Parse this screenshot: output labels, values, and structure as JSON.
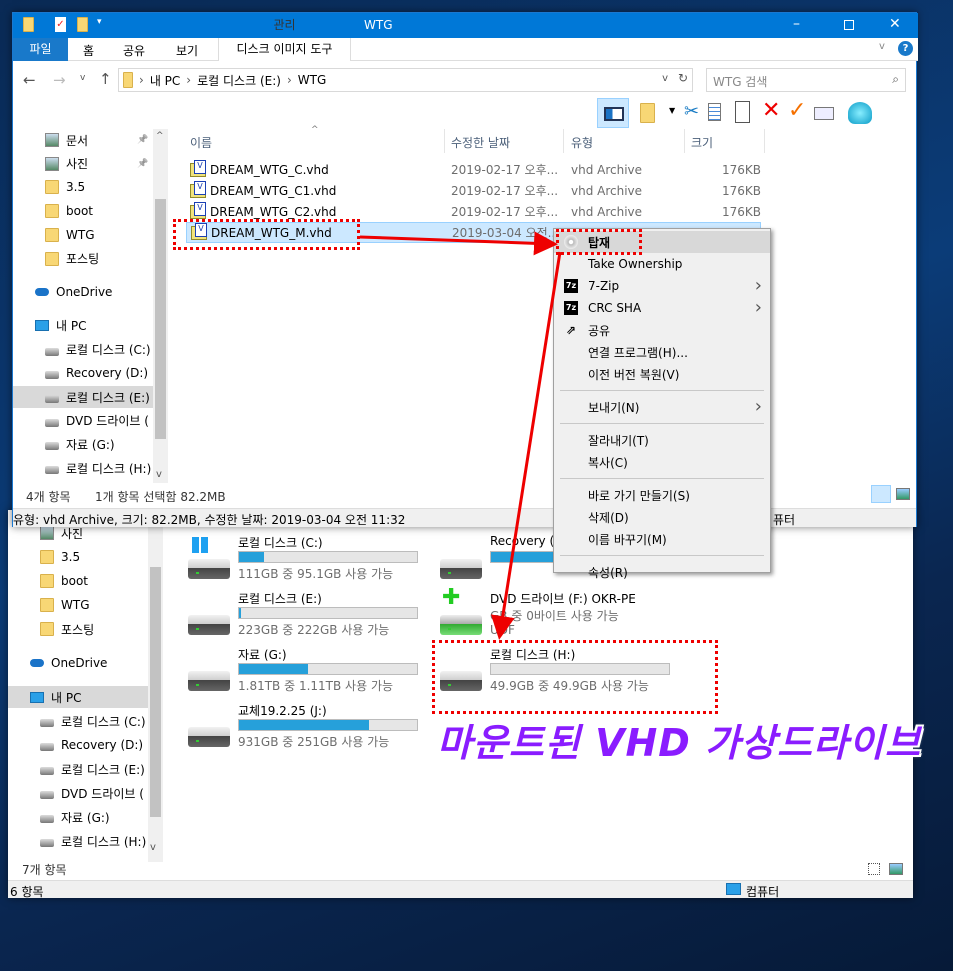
{
  "top_window": {
    "title": "WTG",
    "context_tab": "관리",
    "context_tab_color": "#f9cbb8",
    "ribbon_tabs": [
      "파일",
      "홈",
      "공유",
      "보기"
    ],
    "context_subtab": "디스크 이미지 도구",
    "window_controls": [
      "minimize",
      "maximize",
      "close"
    ],
    "breadcrumb": [
      "내 PC",
      "로컬 디스크 (E:)",
      "WTG"
    ],
    "search_placeholder": "WTG 검색",
    "toolbar_icons": [
      "preview-pane-icon",
      "new-folder-icon",
      "cut-icon",
      "copy-icon",
      "paste-icon",
      "delete-icon",
      "check-icon",
      "properties-icon",
      "shell-icon"
    ],
    "sidebar": [
      {
        "label": "문서",
        "icon": "documents-icon",
        "pinned": true
      },
      {
        "label": "사진",
        "icon": "pictures-icon",
        "pinned": true
      },
      {
        "label": "3.5",
        "icon": "folder-icon"
      },
      {
        "label": "boot",
        "icon": "folder-icon"
      },
      {
        "label": "WTG",
        "icon": "folder-icon"
      },
      {
        "label": "포스팅",
        "icon": "folder-icon"
      },
      {
        "label": "OneDrive",
        "icon": "cloud-icon"
      },
      {
        "label": "내 PC",
        "icon": "pc-icon"
      },
      {
        "label": "로컬 디스크 (C:)",
        "icon": "windows-drive-icon"
      },
      {
        "label": "Recovery (D:)",
        "icon": "drive-icon"
      },
      {
        "label": "로컬 디스크 (E:)",
        "icon": "drive-icon",
        "selected": true
      },
      {
        "label": "DVD 드라이브 (",
        "icon": "dvd-icon"
      },
      {
        "label": "자료 (G:)",
        "icon": "drive-icon"
      },
      {
        "label": "로컬 디스크 (H:)",
        "icon": "drive-icon"
      }
    ],
    "columns": [
      "이름",
      "수정한 날짜",
      "유형",
      "크기"
    ],
    "files": [
      {
        "name": "DREAM_WTG_C.vhd",
        "date": "2019-02-17 오후...",
        "type": "vhd Archive",
        "size": "176KB"
      },
      {
        "name": "DREAM_WTG_C1.vhd",
        "date": "2019-02-17 오후...",
        "type": "vhd Archive",
        "size": "176KB"
      },
      {
        "name": "DREAM_WTG_C2.vhd",
        "date": "2019-02-17 오후...",
        "type": "vhd Archive",
        "size": "176KB"
      },
      {
        "name": "DREAM_WTG_M.vhd",
        "date": "2019-03-04 오전...",
        "type": "",
        "size": "",
        "selected": true
      }
    ],
    "status_count": "4개 항목",
    "status_selected": "1개 항목 선택함 82.2MB",
    "details": "유형: vhd Archive, 크기: 82.2MB, 수정한 날짜: 2019-03-04 오전 11:32",
    "details_right_partial": "퓨터"
  },
  "context_menu": {
    "items": [
      {
        "label": "탑재",
        "icon": "disc-icon",
        "bold": true,
        "highlighted": true
      },
      {
        "label": "Take Ownership"
      },
      {
        "label": "7-Zip",
        "icon": "7zip-icon",
        "submenu": true
      },
      {
        "label": "CRC SHA",
        "icon": "7zip-icon",
        "submenu": true
      },
      {
        "label": "공유",
        "icon": "share-icon"
      },
      {
        "label": "연결 프로그램(H)..."
      },
      {
        "label": "이전 버전 복원(V)"
      },
      {
        "separator": true
      },
      {
        "label": "보내기(N)",
        "submenu": true
      },
      {
        "separator": true
      },
      {
        "label": "잘라내기(T)"
      },
      {
        "label": "복사(C)"
      },
      {
        "separator": true
      },
      {
        "label": "바로 가기 만들기(S)"
      },
      {
        "label": "삭제(D)"
      },
      {
        "label": "이름 바꾸기(M)"
      },
      {
        "separator": true
      },
      {
        "label": "속성(R)"
      }
    ]
  },
  "bottom_window": {
    "sidebar": [
      {
        "label": "사진",
        "icon": "pictures-icon"
      },
      {
        "label": "3.5",
        "icon": "folder-icon"
      },
      {
        "label": "boot",
        "icon": "folder-icon"
      },
      {
        "label": "WTG",
        "icon": "folder-icon"
      },
      {
        "label": "포스팅",
        "icon": "folder-icon"
      },
      {
        "label": "OneDrive",
        "icon": "cloud-icon"
      },
      {
        "label": "내 PC",
        "icon": "pc-icon",
        "selected": true
      },
      {
        "label": "로컬 디스크 (C:)",
        "icon": "windows-drive-icon"
      },
      {
        "label": "Recovery (D:)",
        "icon": "drive-icon"
      },
      {
        "label": "로컬 디스크 (E:)",
        "icon": "drive-icon"
      },
      {
        "label": "DVD 드라이브 (",
        "icon": "dvd-icon"
      },
      {
        "label": "자료 (G:)",
        "icon": "drive-icon"
      },
      {
        "label": "로컬 디스크 (H:)",
        "icon": "drive-icon"
      }
    ],
    "drives": [
      {
        "label": "로컬 디스크 (C:)",
        "free": "111GB 중 95.1GB 사용 가능",
        "used_percent": 14,
        "icon": "windows-drive-icon"
      },
      {
        "label": "Recovery (D:)",
        "free": "",
        "used_percent": 70,
        "icon": "drive-icon"
      },
      {
        "label": "로컬 디스크 (E:)",
        "free": "223GB 중 222GB 사용 가능",
        "used_percent": 0.5,
        "icon": "drive-icon"
      },
      {
        "label": "DVD 드라이브 (F:) OKR-PE",
        "free": "GB 중 0바이트 사용 가능",
        "extra": "UDF",
        "icon": "dvd-icon"
      },
      {
        "label": "자료 (G:)",
        "free": "1.81TB 중 1.11TB 사용 가능",
        "used_percent": 39,
        "icon": "drive-icon"
      },
      {
        "label": "로컬 디스크 (H:)",
        "free": "49.9GB 중 49.9GB 사용 가능",
        "used_percent": 0,
        "icon": "drive-icon"
      },
      {
        "label": "교체19.2.25 (J:)",
        "free": "931GB 중 251GB 사용 가능",
        "used_percent": 73,
        "icon": "drive-icon"
      }
    ],
    "status_count": "7개 항목",
    "footer_count": "6 항목",
    "footer_location": "컴퓨터"
  },
  "annotation": {
    "text": "마운트된 VHD 가상드라이브",
    "color": "#8a1cff",
    "highlight_color": "#e00000"
  }
}
